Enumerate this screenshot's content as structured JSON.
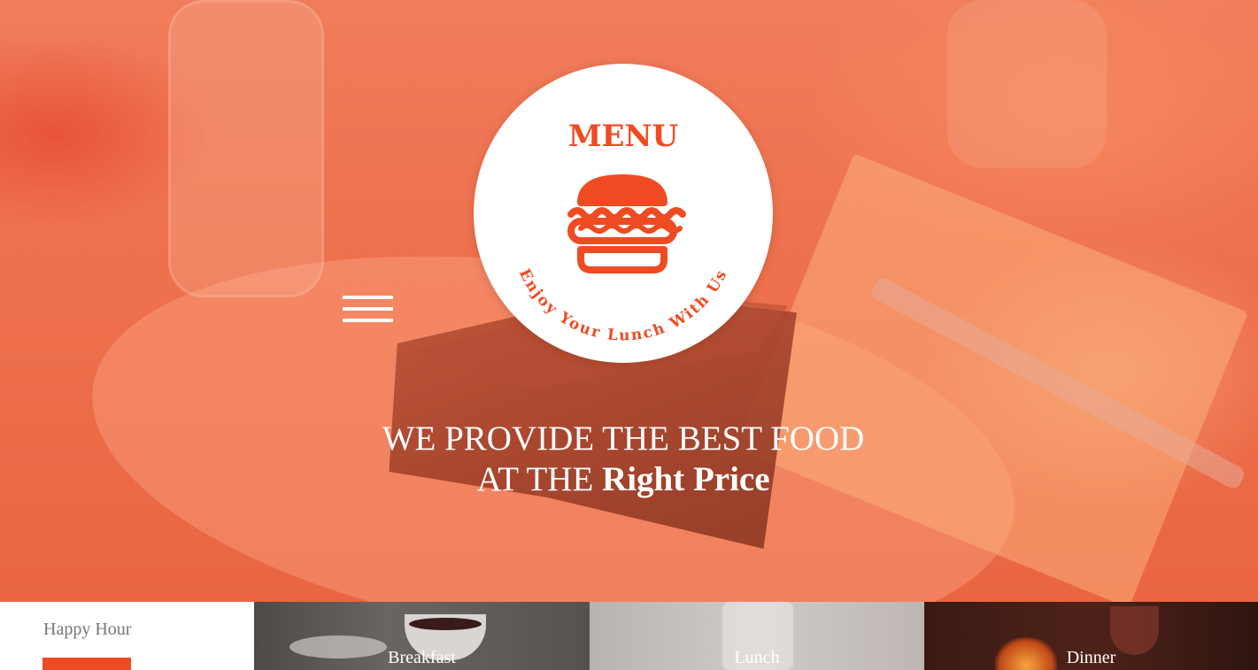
{
  "logo": {
    "title": "MENU",
    "tagline": "Enjoy Your Lunch With Us",
    "burger_icon": "burger-icon"
  },
  "nav": {
    "menu_icon": "hamburger-menu-icon"
  },
  "hero": {
    "headline_line1": "WE PROVIDE THE BEST FOOD",
    "headline_line2_prefix": "AT THE ",
    "headline_line2_emphasis": "Right Price"
  },
  "strip": {
    "happy_hour": "Happy Hour",
    "tiles": [
      {
        "label": "Breakfast"
      },
      {
        "label": "Lunch"
      },
      {
        "label": "Dinner"
      }
    ]
  },
  "colors": {
    "accent": "#ef4b23",
    "hero_tint": "#ee7a58",
    "text_light": "#ffffff",
    "text_muted": "#777777"
  }
}
